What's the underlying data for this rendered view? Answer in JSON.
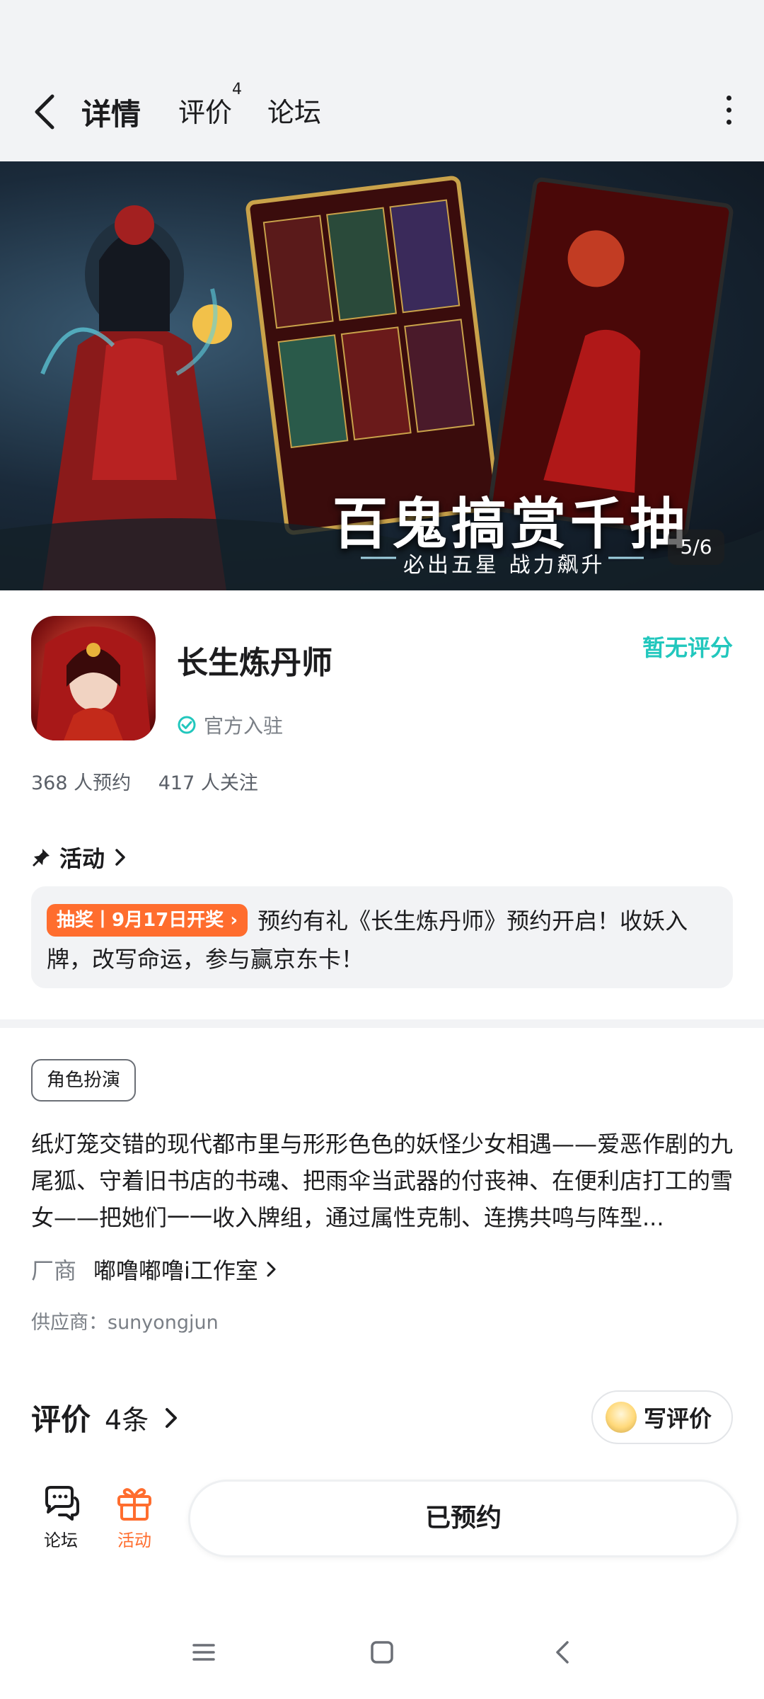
{
  "nav": {
    "tabs": [
      {
        "label": "详情",
        "active": true
      },
      {
        "label": "评价",
        "badge": "4"
      },
      {
        "label": "论坛"
      }
    ]
  },
  "banner": {
    "title": "百鬼搞赏千抽",
    "subtitle": "必出五星 战力飙升",
    "indicator": "5/6"
  },
  "app": {
    "name": "长生炼丹师",
    "official_label": "官方入驻",
    "rating_text": "暂无评分",
    "reservations": "368 人预约",
    "followers": "417 人关注"
  },
  "activity": {
    "header": "活动",
    "badge": "抽奖丨9月17日开奖",
    "text": "预约有礼《长生炼丹师》预约开启！收妖入牌，改写命运，参与赢京东卡！"
  },
  "details": {
    "genre_tag": "角色扮演",
    "description": "纸灯笼交错的现代都市里与形形色色的妖怪少女相遇——爱恶作剧的九尾狐、守着旧书店的书魂、把雨伞当武器的付丧神、在便利店打工的雪女——把她们一一收入牌组，通过属性克制、连携共鸣与阵型...",
    "developer_label": "厂商",
    "developer_value": "嘟噜嘟噜i工作室",
    "supplier": "供应商：sunyongjun"
  },
  "reviews": {
    "title": "评价",
    "count": "4条",
    "write_label": "写评价"
  },
  "bottom": {
    "forum_label": "论坛",
    "activity_label": "活动",
    "reserved_label": "已预约"
  },
  "colors": {
    "accent": "#22c7bd",
    "orange": "#ff6d2e"
  }
}
